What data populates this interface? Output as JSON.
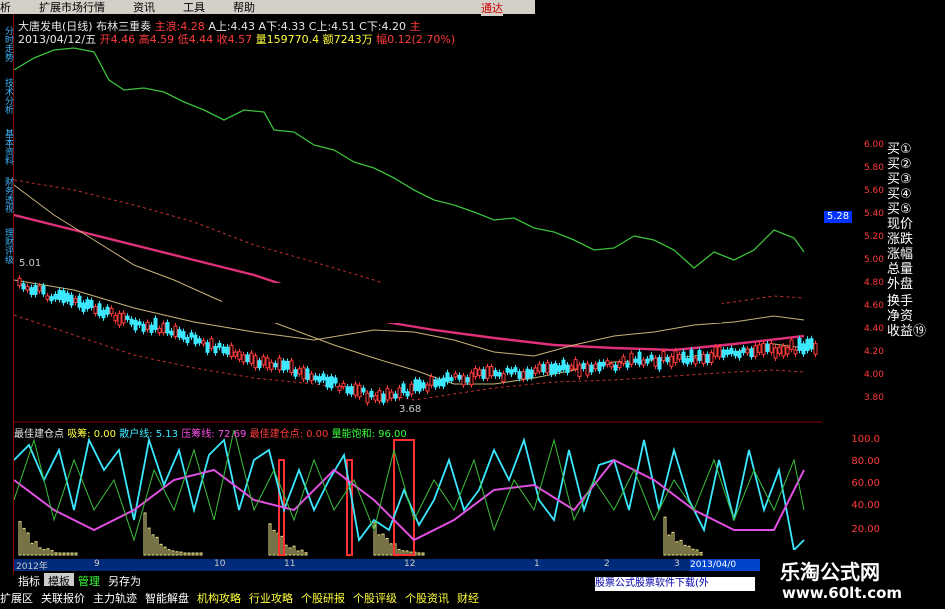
{
  "menubar": {
    "items": [
      "析",
      "扩展市场行情",
      "资讯",
      "工具",
      "帮助"
    ],
    "right": "通达"
  },
  "header": {
    "line1": {
      "stock": "大唐发电(日线)",
      "indicator": "布林三重奏",
      "main_label": "主浪:",
      "main_val": "4.28",
      "a_up": "A上:4.43",
      "a_down": "A下:4.33",
      "c_up": "C上:4.51",
      "c_down": "C下:4.20",
      "tail": "主"
    },
    "line2": {
      "date": "2013/04/12/五",
      "open": "开4.46",
      "high": "高4.59",
      "low": "低4.44",
      "close": "收4.57",
      "vol": "量159770.4",
      "amount": "额7243万",
      "chg": "幅0.12(2.70%)"
    }
  },
  "left_tabs": [
    "分时走势",
    "技术分析",
    "基本资料",
    "财务透视",
    "理财评级"
  ],
  "right_panel": {
    "items": [
      "买①",
      "买②",
      "买③",
      "买④",
      "买⑤",
      "现价",
      "涨跌",
      "涨幅",
      "总量",
      "外盘",
      "换手",
      "净资",
      "收益⑲"
    ]
  },
  "price_axis": {
    "ticks": [
      "6.00",
      "5.80",
      "5.60",
      "5.40",
      "5.20",
      "5.00",
      "4.80",
      "4.60",
      "4.40",
      "4.20",
      "4.00",
      "3.80"
    ],
    "current": "5.28"
  },
  "annotations": {
    "high": "5.01",
    "low": "3.68"
  },
  "indicator": {
    "title": "最佳建仓点",
    "xichou": "吸筹: 0.00",
    "sanhu": "散户线: 5.13",
    "yachou": "压筹线: 72.69",
    "jiancang": "最佳建仓点: 0.00",
    "liangneng": "量能饱和: 96.00",
    "ticks": [
      "100.0",
      "80.00",
      "60.00",
      "40.00",
      "20.00"
    ]
  },
  "date_bar": {
    "labels": [
      "2012年",
      "9",
      "10",
      "11",
      "12",
      "1",
      "2",
      "3"
    ],
    "tag": "2013/04/0"
  },
  "tabs": [
    {
      "label": "指标",
      "state": "normal"
    },
    {
      "label": "模板",
      "state": "active"
    },
    {
      "label": "管理",
      "state": "green"
    },
    {
      "label": "另存为",
      "state": "normal"
    }
  ],
  "bottom_bar": [
    "扩展区",
    "关联报价",
    "主力轨迹",
    "智能解盘",
    "机构攻略",
    "行业攻略",
    "个股研报",
    "个股评级",
    "个股资讯",
    "财经",
    "股票公式股票软件下载(外"
  ],
  "promo": "股票公式股票软件下载(外",
  "watermark": {
    "line1": "乐淘公式网",
    "line2": "www.60lt.com"
  },
  "colors": {
    "up": "#ff3b3b",
    "down": "#3be8ff",
    "green_line": "#3bbf3b",
    "ma_yellow": "#c8b478",
    "ma_pink": "#e0307a",
    "boll_red": "#c03030",
    "axis": "#ff3b3b"
  }
}
